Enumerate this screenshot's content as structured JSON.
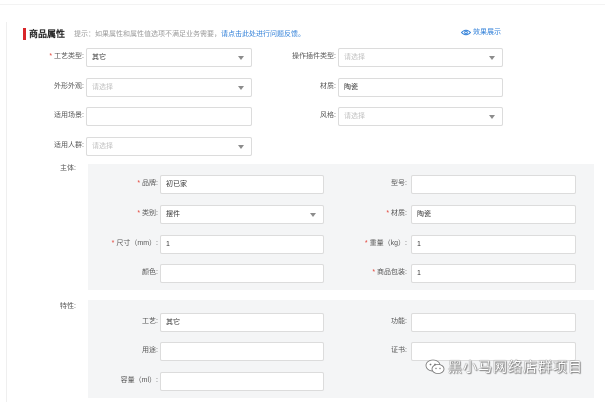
{
  "header": {
    "title": "商品属性",
    "hint_prefix": "提示：如果属性和属性值选项不满足业务需要，",
    "hint_link": "请点击此处进行问题反馈。",
    "effect_link": "效果展示"
  },
  "fields": {
    "craft_type": {
      "label": "工艺类型:",
      "value": "其它",
      "required": true
    },
    "operation_type": {
      "label": "操作插件类型:",
      "placeholder": "请选择"
    },
    "appearance": {
      "label": "外形外观:",
      "placeholder": "请选择"
    },
    "material": {
      "label": "材质:",
      "value": "陶瓷"
    },
    "scene": {
      "label": "适用场景:",
      "value": ""
    },
    "style": {
      "label": "风格:",
      "placeholder": "请选择"
    },
    "audience": {
      "label": "适用人群:",
      "placeholder": "请选择"
    }
  },
  "main_body": {
    "label": "主体:",
    "brand": {
      "label": "品牌:",
      "value": "初已家",
      "required": true
    },
    "model": {
      "label": "型号:",
      "value": ""
    },
    "category": {
      "label": "类别:",
      "value": "摆件",
      "required": true
    },
    "material": {
      "label": "材质:",
      "value": "陶瓷",
      "required": true
    },
    "size": {
      "label": "尺寸（mm）:",
      "value": "1",
      "required": true
    },
    "weight": {
      "label": "重量（kg）:",
      "value": "1",
      "required": true
    },
    "color": {
      "label": "颜色:",
      "value": ""
    },
    "package": {
      "label": "商品包装:",
      "value": "1",
      "required": true
    }
  },
  "features": {
    "label": "特性:",
    "craft": {
      "label": "工艺:",
      "value": "其它"
    },
    "function": {
      "label": "功能:",
      "value": ""
    },
    "usage": {
      "label": "用途:",
      "value": ""
    },
    "certificate": {
      "label": "证书:",
      "value": ""
    },
    "capacity": {
      "label": "容量（ml）:",
      "value": ""
    }
  },
  "watermark": {
    "text": "黑小马网络店群项目",
    "icon": "wechat-icon"
  },
  "colors": {
    "accent": "#d9262a",
    "link": "#2f7fd8",
    "required": "#e1352a",
    "panel": "#f4f5f6"
  }
}
